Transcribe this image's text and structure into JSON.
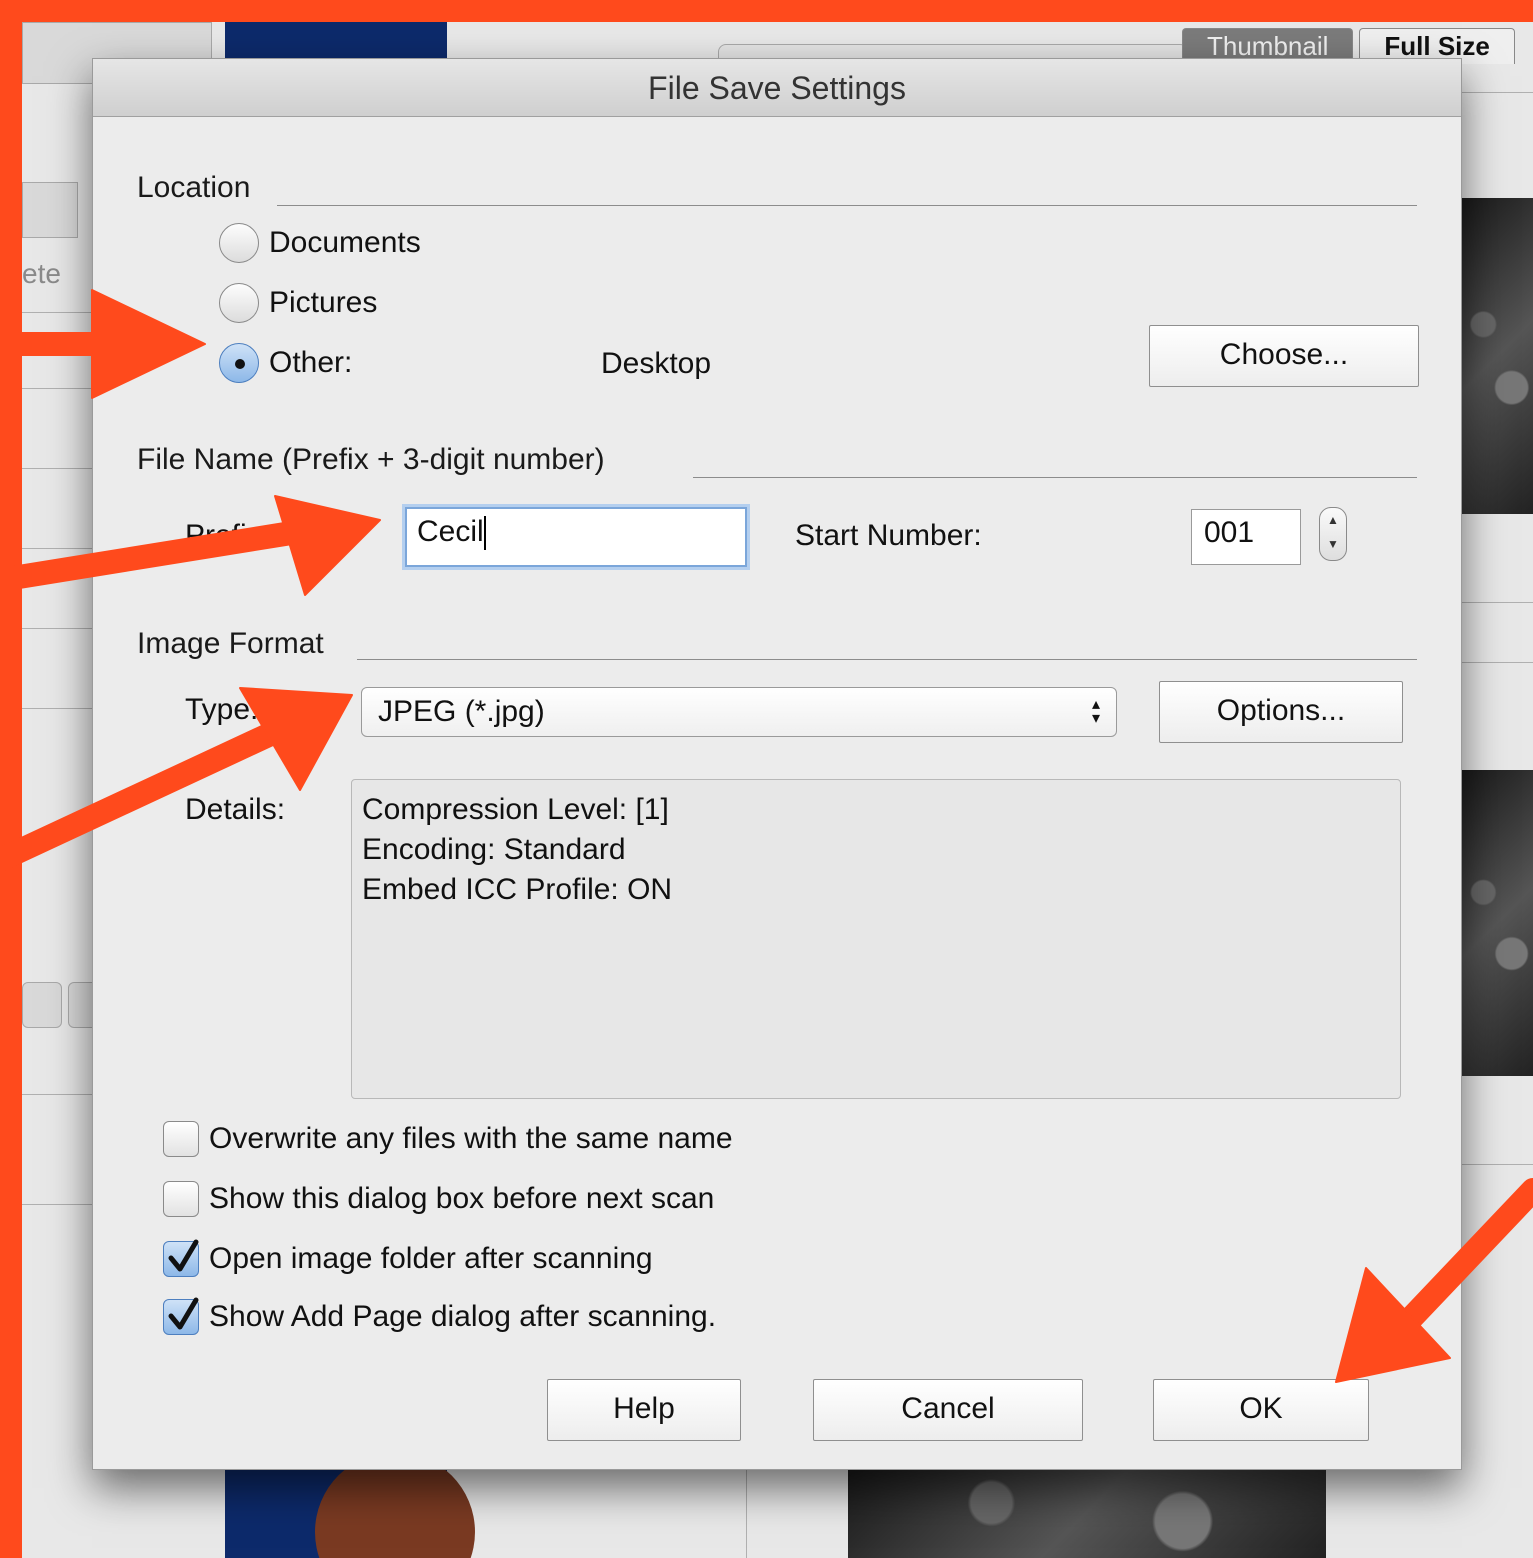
{
  "background": {
    "tabs": [
      {
        "label": "Thumbnail",
        "active": false
      },
      {
        "label": "Full Size",
        "active": true
      }
    ],
    "partial_text": "ete"
  },
  "dialog": {
    "title": "File Save Settings",
    "location": {
      "label": "Location",
      "options": [
        {
          "label": "Documents",
          "selected": false
        },
        {
          "label": "Pictures",
          "selected": false
        },
        {
          "label": "Other:",
          "selected": true
        }
      ],
      "other_value": "Desktop",
      "choose_button": "Choose..."
    },
    "file_name": {
      "label": "File Name (Prefix + 3-digit number)",
      "prefix_label": "Prefix:",
      "prefix_value": "Cecil",
      "start_number_label": "Start Number:",
      "start_number_value": "001"
    },
    "image_format": {
      "label": "Image Format",
      "type_label": "Type:",
      "type_value": "JPEG (*.jpg)",
      "options_button": "Options...",
      "details_label": "Details:",
      "details_lines": [
        "Compression Level: [1]",
        "Encoding: Standard",
        "Embed ICC Profile: ON"
      ]
    },
    "checkboxes": [
      {
        "label": "Overwrite any files with the same name",
        "checked": false
      },
      {
        "label": "Show this dialog box before next scan",
        "checked": false
      },
      {
        "label": "Open image folder after scanning",
        "checked": true
      },
      {
        "label": "Show Add Page dialog after scanning.",
        "checked": true
      }
    ],
    "buttons": {
      "help": "Help",
      "cancel": "Cancel",
      "ok": "OK"
    }
  },
  "colors": {
    "annotation": "#FF4A1C",
    "frame": "#000000",
    "focus": "#7BA6DA"
  }
}
